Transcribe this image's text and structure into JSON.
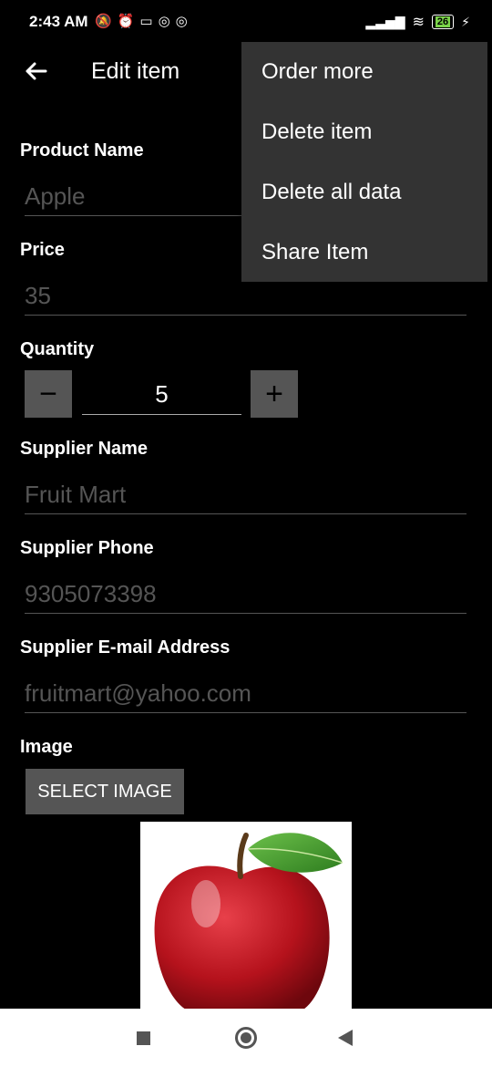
{
  "status_bar": {
    "time": "2:43 AM",
    "battery": "26"
  },
  "app_bar": {
    "title": "Edit item"
  },
  "form": {
    "product_name": {
      "label": "Product Name",
      "placeholder": "Apple"
    },
    "price": {
      "label": "Price",
      "placeholder": "35"
    },
    "quantity": {
      "label": "Quantity",
      "value": "5",
      "decrement": "−",
      "increment": "+"
    },
    "supplier_name": {
      "label": "Supplier Name",
      "placeholder": "Fruit Mart"
    },
    "supplier_phone": {
      "label": "Supplier Phone",
      "placeholder": "9305073398"
    },
    "supplier_email": {
      "label": "Supplier E-mail Address",
      "placeholder": "fruitmart@yahoo.com"
    },
    "image": {
      "label": "Image",
      "button": "SELECT IMAGE"
    }
  },
  "overflow_menu": {
    "items": [
      "Order more",
      "Delete item",
      "Delete all data",
      "Share Item"
    ]
  },
  "colors": {
    "accent_leaf": "#3b9a2f",
    "apple_red": "#c0161f"
  }
}
